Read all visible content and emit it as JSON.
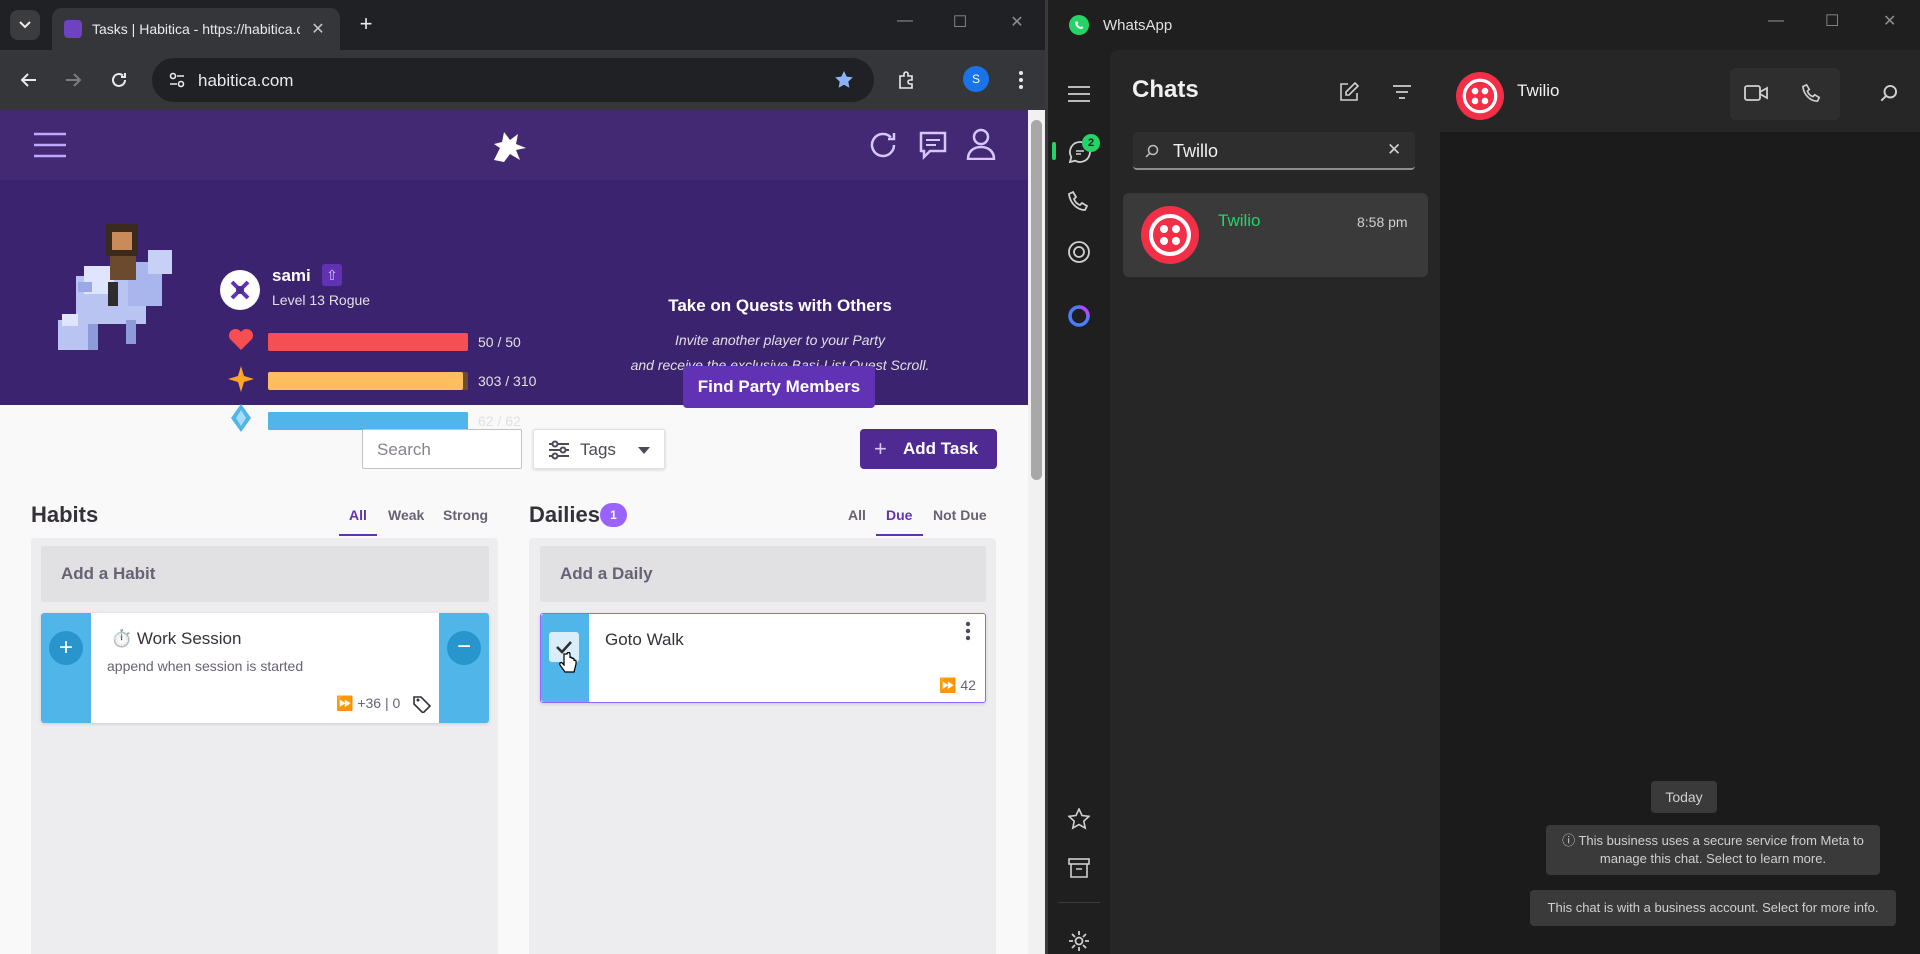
{
  "browser": {
    "tab_title": "Tasks | Habitica - https://habitica.com",
    "url": "habitica.com",
    "profile_initial": "S"
  },
  "habitica": {
    "user": {
      "name": "sami",
      "level": "Level 13 Rogue"
    },
    "stats": {
      "health": {
        "text": "50 / 50",
        "fraction": 1.0,
        "color": "#f74e52"
      },
      "experience": {
        "text": "303 / 310",
        "fraction": 0.977,
        "color": "#ffbe5d"
      },
      "mana": {
        "text": "62 / 62",
        "fraction": 1.0,
        "color": "#50b5e9"
      }
    },
    "quest": {
      "title": "Take on Quests with Others",
      "line1": "Invite another player to your Party",
      "line2": "and receive the exclusive Basi-List Quest Scroll.",
      "button": "Find Party Members"
    },
    "search_placeholder": "Search",
    "tags_label": "Tags",
    "add_task": "Add Task",
    "habits": {
      "title": "Habits",
      "filters": [
        "All",
        "Weak",
        "Strong"
      ],
      "add_label": "Add a Habit",
      "task": {
        "icon": "⏱️",
        "title": "Work Session",
        "notes": "append when session is started",
        "meta": "+36 | 0"
      }
    },
    "dailies": {
      "title": "Dailies",
      "badge": "1",
      "filters": [
        "All",
        "Due",
        "Not Due"
      ],
      "add_label": "Add a Daily",
      "task": {
        "title": "Goto Walk",
        "streak": "42"
      }
    }
  },
  "whatsapp": {
    "app_title": "WhatsApp",
    "chats_title": "Chats",
    "unread_badge": "2",
    "search_value": "Twillo",
    "chat_item": {
      "name": "Twilio",
      "time": "8:58 pm"
    },
    "chat_header_name": "Twilio",
    "date_chip": "Today",
    "notice1_line1": "ⓘ This business uses a secure service from Meta to",
    "notice1_line2": "manage this chat. Select to learn more.",
    "notice2": "This chat is with a business account. Select for more info."
  }
}
